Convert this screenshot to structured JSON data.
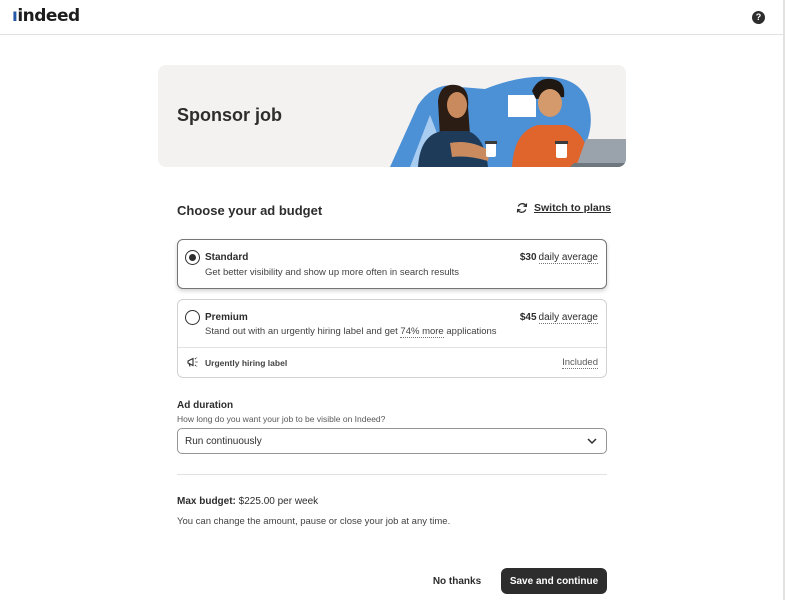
{
  "header": {
    "logo_text": "indeed",
    "help_icon": "question-circle-icon",
    "help_glyph": "?"
  },
  "hero": {
    "title": "Sponsor job",
    "illustration": "two-people-with-coffee-and-laptop"
  },
  "budget": {
    "title": "Choose your ad budget",
    "switch_icon": "refresh-icon",
    "switch_label": "Switch to plans",
    "options": [
      {
        "name": "Standard",
        "description": "Get better visibility and show up more often in search results",
        "price": "$30",
        "price_suffix": "daily average",
        "selected": true
      },
      {
        "name": "Premium",
        "description_before": "Stand out with an urgently hiring label and get ",
        "description_highlight": "74% more",
        "description_after": " applications",
        "price": "$45",
        "price_suffix": "daily average",
        "selected": false,
        "feature_icon": "megaphone-icon",
        "feature_label": "Urgently hiring label",
        "feature_status": "Included"
      }
    ]
  },
  "duration": {
    "title": "Ad duration",
    "help_text": "How long do you want your job to be visible on Indeed?",
    "selected_value": "Run continuously",
    "chevron_icon": "chevron-down-icon"
  },
  "summary": {
    "max_budget_label": "Max  budget:",
    "max_budget_value": "$225.00 per week",
    "note": "You can change the amount, pause or close your job at any time."
  },
  "actions": {
    "no_thanks": "No thanks",
    "save": "Save and continue"
  },
  "colors": {
    "primary_dark": "#2d2d2d",
    "brand_blue": "#2557a7",
    "hero_bg": "#f3f2f1",
    "illustration_blue": "#4c90d6",
    "illustration_orange": "#e0652c"
  }
}
